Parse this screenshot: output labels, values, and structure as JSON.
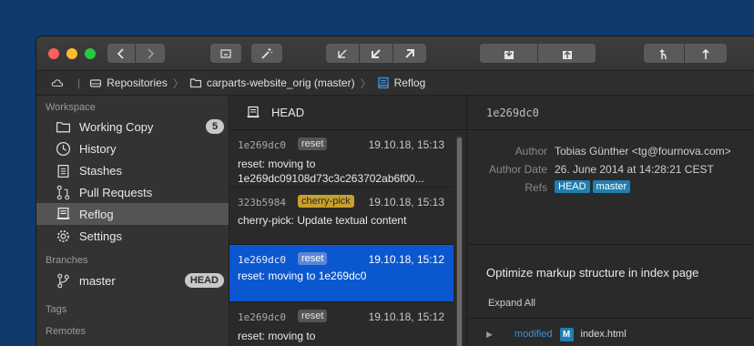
{
  "pathbar": {
    "repositories": "Repositories",
    "repo": "carparts-website_orig (master)",
    "current": "Reflog"
  },
  "sidebar": {
    "workspace_title": "Workspace",
    "items": [
      {
        "label": "Working Copy",
        "icon": "folder-icon",
        "badge": "5"
      },
      {
        "label": "History",
        "icon": "clock-icon"
      },
      {
        "label": "Stashes",
        "icon": "clipboard-icon"
      },
      {
        "label": "Pull Requests",
        "icon": "pull-request-icon"
      },
      {
        "label": "Reflog",
        "icon": "reflog-icon",
        "selected": true
      },
      {
        "label": "Settings",
        "icon": "gear-icon"
      }
    ],
    "branches_title": "Branches",
    "branch": {
      "label": "master",
      "badge": "HEAD"
    },
    "tags_title": "Tags",
    "remotes_title": "Remotes"
  },
  "middle": {
    "header": "HEAD",
    "entries": [
      {
        "hash": "1e269dc0",
        "tag": "reset",
        "date": "19.10.18, 15:13",
        "msg1": "reset: moving to",
        "msg2": "1e269dc09108d73c3c263702ab6f00..."
      },
      {
        "hash": "323b5984",
        "tag": "cherry-pick",
        "date": "19.10.18, 15:13",
        "msg1": "cherry-pick: Update textual content",
        "msg2": ""
      },
      {
        "hash": "1e269dc0",
        "tag": "reset",
        "date": "19.10.18, 15:12",
        "msg1": "reset: moving to 1e269dc0",
        "msg2": ""
      },
      {
        "hash": "1e269dc0",
        "tag": "reset",
        "date": "19.10.18, 15:12",
        "msg1": "reset: moving to",
        "msg2": ""
      }
    ]
  },
  "detail": {
    "hash": "1e269dc0",
    "author_label": "Author",
    "author": "Tobias Günther <tg@fournova.com>",
    "date_label": "Author Date",
    "date": "26. June 2014 at 14:28:21 CEST",
    "refs_label": "Refs",
    "refs": [
      "HEAD",
      "master"
    ],
    "subject": "Optimize markup structure in index page",
    "expand_all": "Expand All",
    "file": {
      "status": "modified",
      "badge": "M",
      "name": "index.html"
    }
  },
  "colors": {
    "selection": "#0b57d0",
    "ref_badge": "#1f7fb0",
    "cherry_pick": "#c8a02c",
    "modified": "#3b8fd6"
  }
}
